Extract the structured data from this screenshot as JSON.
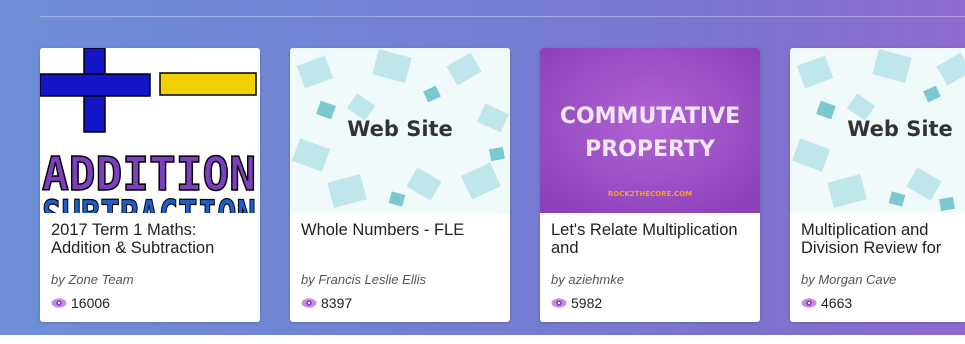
{
  "colors": {
    "band_start": "#6f8fd8",
    "band_end": "#8d6bd0",
    "eye_icon": "#b16fd8",
    "commutative_bg": "#9a4fc4"
  },
  "cards": [
    {
      "title": "2017 Term 1 Maths: Addition & Subtraction",
      "author": "by Zone Team",
      "views": "16006",
      "thumb": {
        "kind": "addition",
        "line1": "ADDITION",
        "line2": "SUBTRACTION"
      }
    },
    {
      "title": "Whole Numbers - FLE",
      "author": "by Francis Leslie Ellis",
      "views": "8397",
      "thumb": {
        "kind": "website",
        "label": "Web Site"
      }
    },
    {
      "title": "Let's Relate Multiplication and",
      "author": "by aziehmke",
      "views": "5982",
      "thumb": {
        "kind": "commutative",
        "line1": "COMMUTATIVE",
        "line2": "PROPERTY",
        "badge": "ROCK2THECORE.COM"
      }
    },
    {
      "title": "Multiplication and Division Review for",
      "author": "by Morgan Cave",
      "views": "4663",
      "thumb": {
        "kind": "website",
        "label": "Web Site"
      }
    }
  ]
}
